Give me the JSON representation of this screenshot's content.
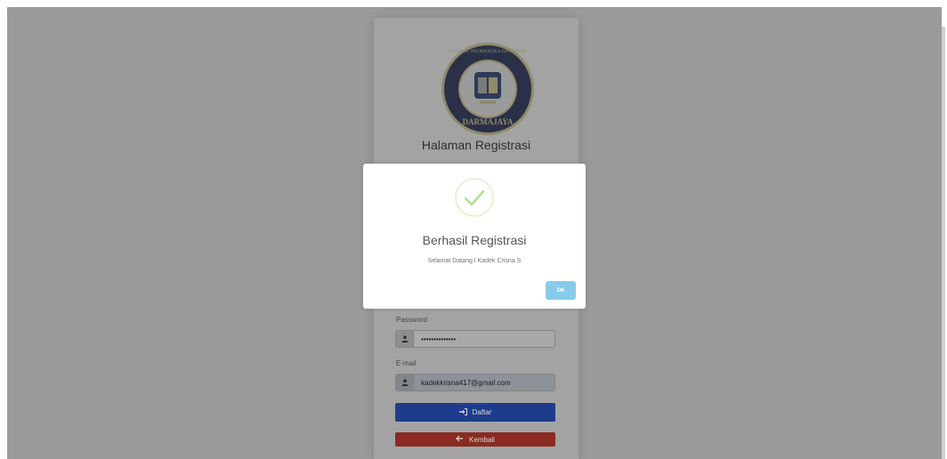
{
  "page": {
    "heading": "Halaman Registrasi"
  },
  "form": {
    "password_label": "Password",
    "password_value": "••••••••••••••",
    "email_label": "E-mail",
    "email_value": "kadekkrisna417@gmail.com",
    "register_button": "Daftar",
    "back_button": "Kembali"
  },
  "dialog": {
    "title": "Berhasil Registrasi",
    "message": "Selamat Datang I Kadek Crisna S",
    "ok_button": "OK"
  },
  "logo": {
    "name": "logo-institut-darmajaya",
    "ring_text_top": "INSTITUT INFORMATIKA DAN BISNIS",
    "ring_text_bottom": "DARMAJAYA"
  },
  "icons": {
    "success": "check-icon",
    "field": "user-icon",
    "register": "sign-in-icon",
    "back": "arrow-left-icon"
  },
  "colors": {
    "overlay": "#9a9a9a",
    "primary_button": "#1d3d8c",
    "danger_button": "#8a2a21",
    "ok_button": "#87cbea",
    "success": "#a5dc86"
  }
}
